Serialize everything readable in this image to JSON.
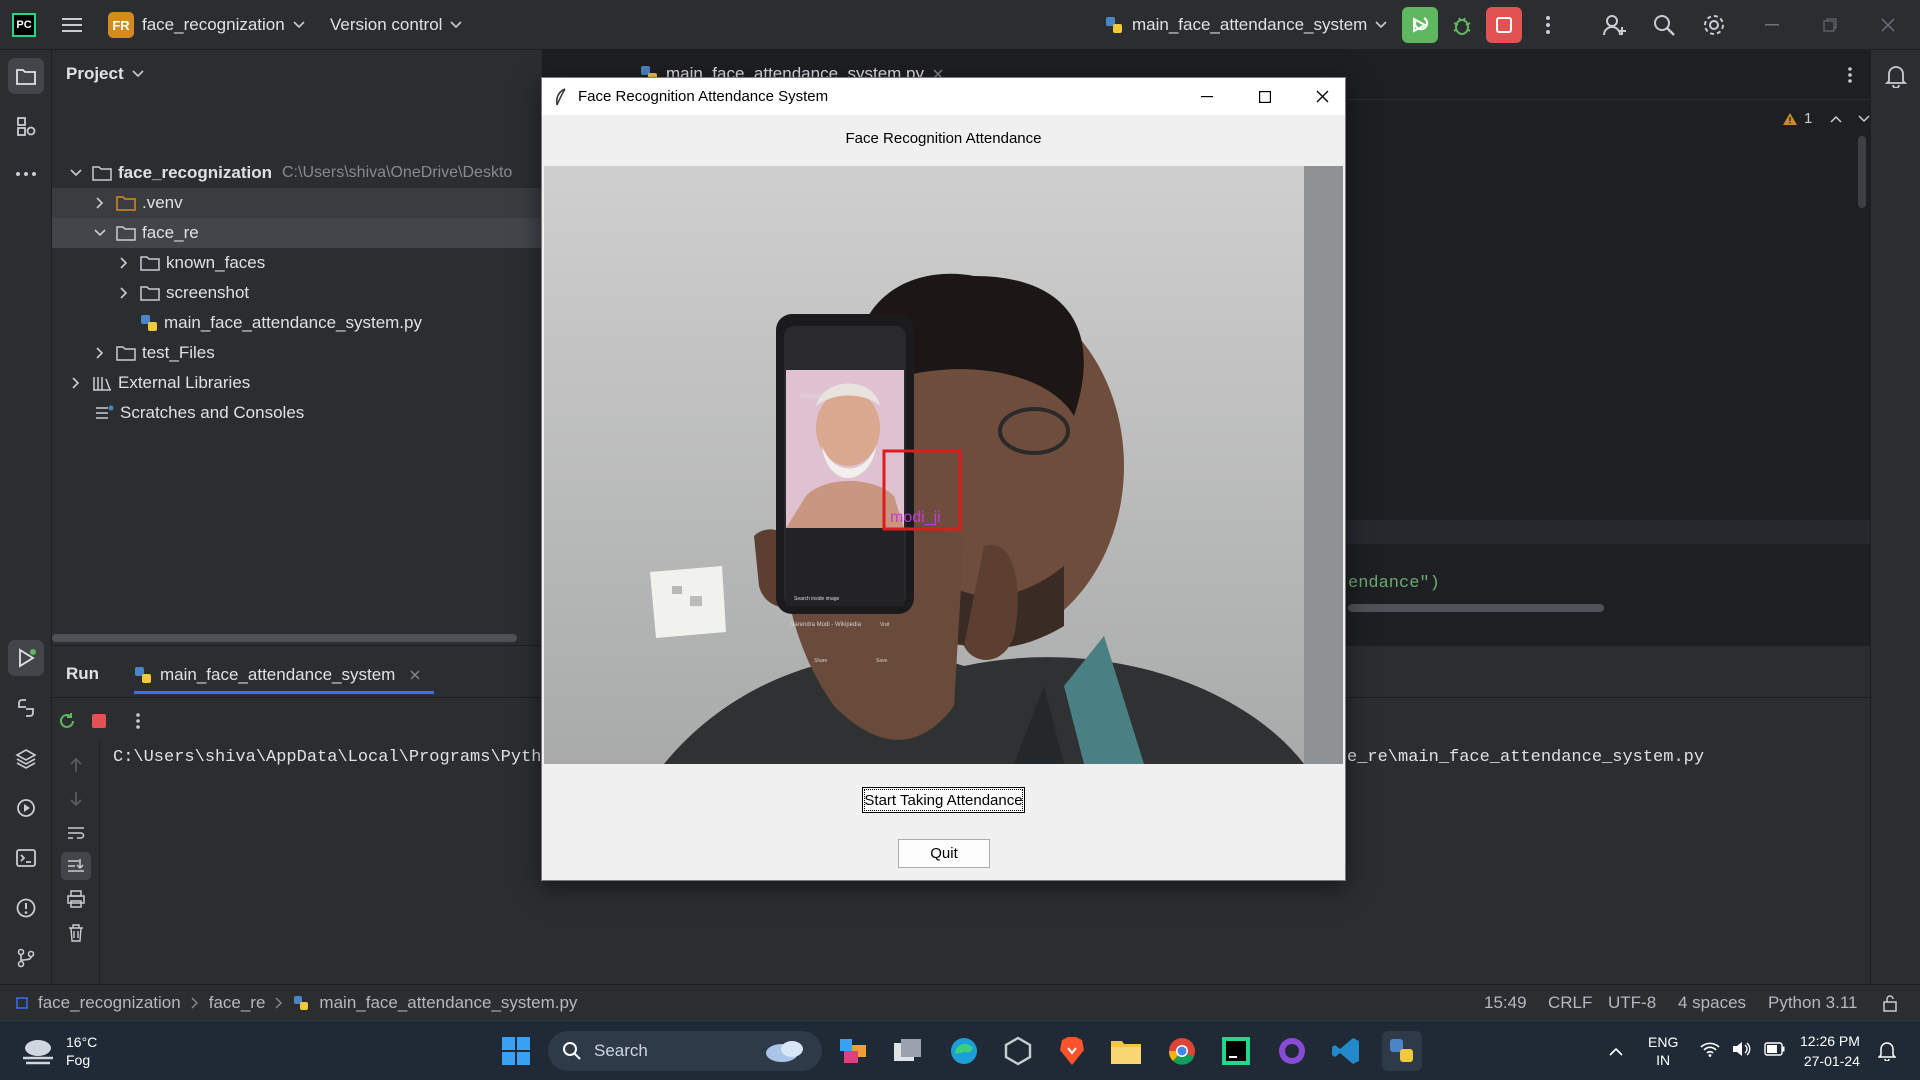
{
  "ide": {
    "project_badge": "FR",
    "project_name": "face_recognization",
    "vcs_label": "Version control",
    "run_config": "main_face_attendance_system",
    "colors": {
      "accent_green": "#5fb85f",
      "stop_red": "#e35252",
      "badge_orange": "#d38b21"
    }
  },
  "project_panel": {
    "title": "Project",
    "tree": [
      {
        "label": "face_recognization",
        "path_hint": "C:\\Users\\shiva\\OneDrive\\Deskto",
        "icon": "folder-icon",
        "expanded": true
      },
      {
        "label": ".venv",
        "icon": "folder-icon"
      },
      {
        "label": "face_re",
        "icon": "folder-icon",
        "expanded": true
      },
      {
        "label": "known_faces",
        "icon": "folder-icon"
      },
      {
        "label": "screenshot",
        "icon": "folder-icon"
      },
      {
        "label": "main_face_attendance_system.py",
        "icon": "python-file-icon"
      },
      {
        "label": "test_Files",
        "icon": "folder-icon"
      },
      {
        "label": "External Libraries",
        "icon": "library-icon"
      },
      {
        "label": "Scratches and Consoles",
        "icon": "scratches-icon"
      }
    ]
  },
  "editor": {
    "tab": "main_face_attendance_system.py",
    "warning_count": "1",
    "visible_code_fragment": "endance\")"
  },
  "run_panel": {
    "title": "Run",
    "tab": "main_face_attendance_system",
    "console_line_start": "C:\\Users\\shiva\\AppData\\Local\\Programs\\Pytho",
    "console_line_end": "e_re\\main_face_attendance_system.py"
  },
  "status_bar": {
    "breadcrumb": [
      "face_recognization",
      "face_re",
      "main_face_attendance_system.py"
    ],
    "position": "15:49",
    "line_sep": "CRLF",
    "encoding": "UTF-8",
    "indent": "4 spaces",
    "interpreter": "Python 3.11"
  },
  "dialog": {
    "window_title": "Face Recognition Attendance System",
    "heading": "Face Recognition Attendance",
    "detected_label": "modi_ji",
    "phone_text": {
      "wiki": "Wikipedia",
      "search": "Search inside image",
      "caption": "Narendra Modi - Wikipedia",
      "share": "Share",
      "save": "Save",
      "visit": "Visit"
    },
    "start_button": "Start Taking Attendance",
    "quit_button": "Quit"
  },
  "taskbar": {
    "weather_temp": "16°C",
    "weather_desc": "Fog",
    "search_label": "Search",
    "lang_top": "ENG",
    "lang_bottom": "IN",
    "time": "12:26 PM",
    "date": "27-01-24"
  }
}
